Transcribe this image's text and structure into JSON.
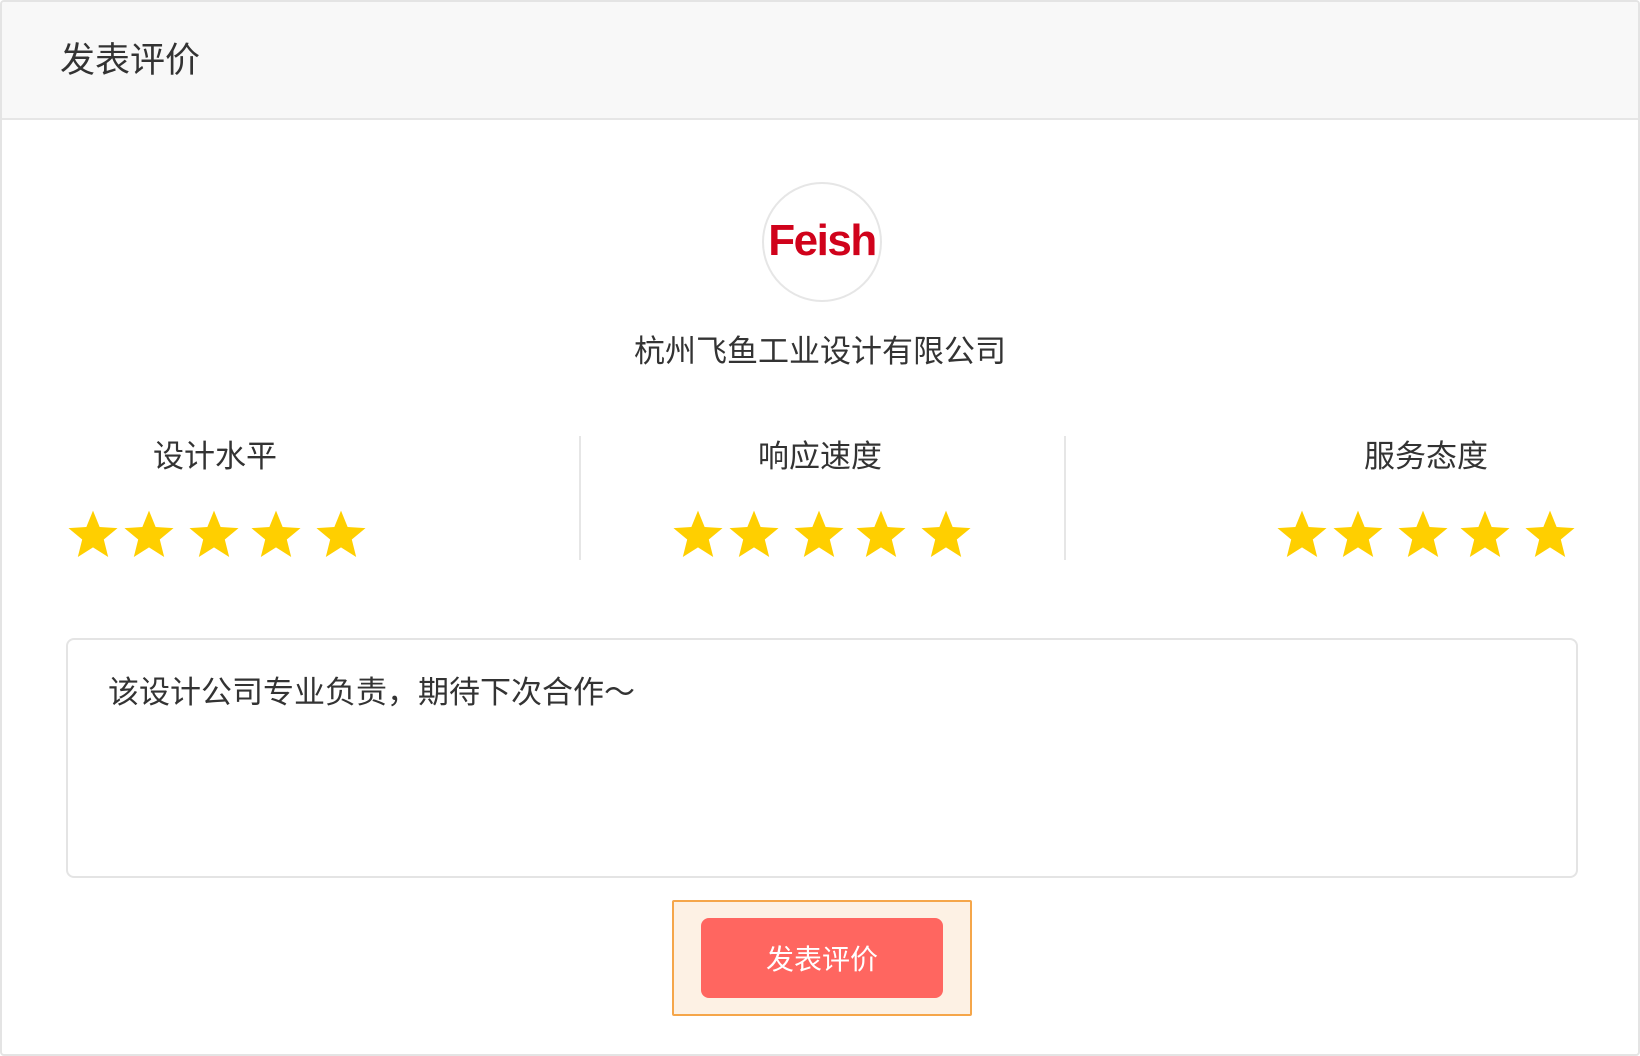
{
  "header": {
    "title": "发表评价"
  },
  "company": {
    "logo_text": "Feish",
    "name": "杭州飞鱼工业设计有限公司"
  },
  "ratings": [
    {
      "label": "设计水平",
      "stars": 5
    },
    {
      "label": "响应速度",
      "stars": 5
    },
    {
      "label": "服务态度",
      "stars": 5
    }
  ],
  "colors": {
    "star": "#ffcf00",
    "button": "#ff6660",
    "logo": "#d0021b"
  },
  "icons": {
    "star": "star-icon"
  },
  "comment": {
    "text": "该设计公司专业负责，期待下次合作～"
  },
  "submit": {
    "label": "发表评价"
  }
}
